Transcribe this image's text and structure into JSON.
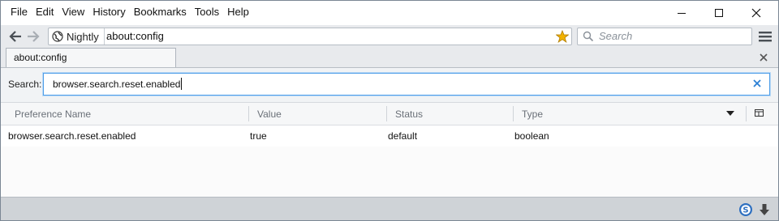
{
  "menu": {
    "items": [
      "File",
      "Edit",
      "View",
      "History",
      "Bookmarks",
      "Tools",
      "Help"
    ]
  },
  "window_controls": {
    "minimize_icon": "minimize-icon",
    "maximize_icon": "maximize-icon",
    "close_icon": "close-icon"
  },
  "navbar": {
    "identity_label": "Nightly",
    "url": "about:config",
    "search_placeholder": "Search"
  },
  "tab": {
    "title": "about:config"
  },
  "config": {
    "search_label": "Search:",
    "filter_value": "browser.search.reset.enabled",
    "columns": [
      "Preference Name",
      "Value",
      "Status",
      "Type"
    ],
    "rows": [
      {
        "name": "browser.search.reset.enabled",
        "value": "true",
        "status": "default",
        "type": "boolean"
      }
    ]
  },
  "colors": {
    "accent": "#4f9ee8",
    "star": "#f2b200",
    "status_bar": "#cfd3d7"
  }
}
